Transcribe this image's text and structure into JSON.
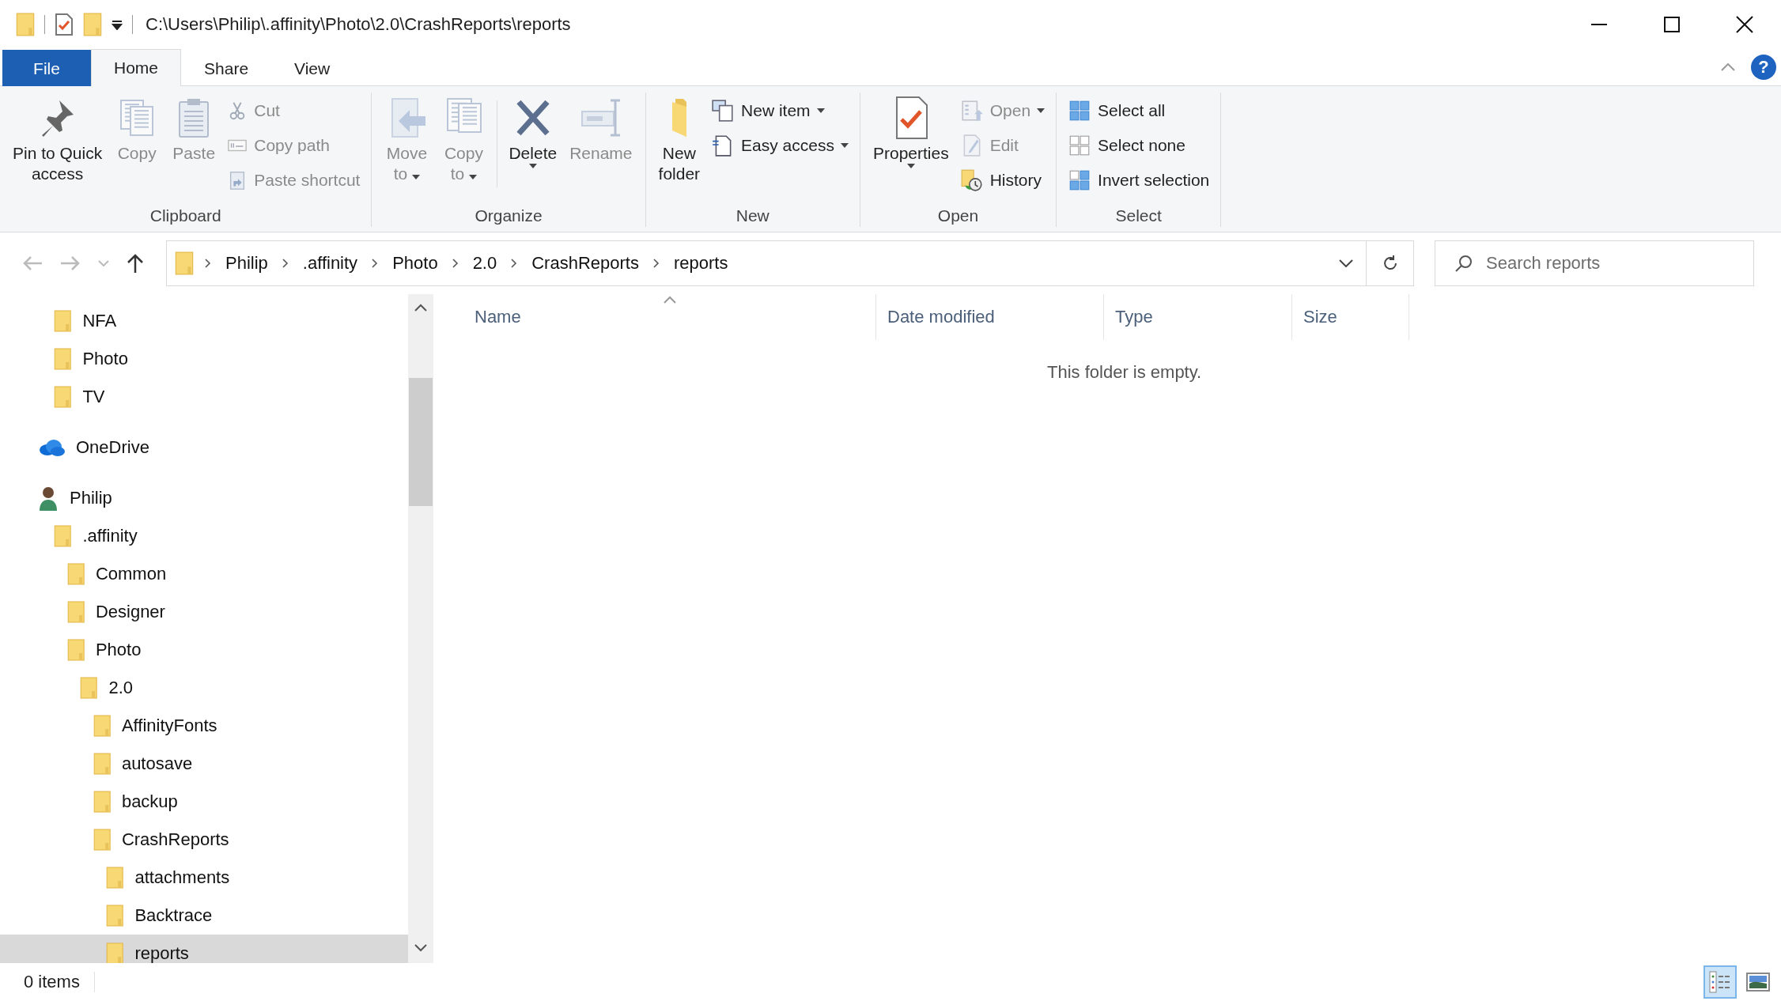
{
  "window": {
    "title": "C:\\Users\\Philip\\.affinity\\Photo\\2.0\\CrashReports\\reports"
  },
  "tabs": [
    {
      "label": "File",
      "kind": "file",
      "selected": false
    },
    {
      "label": "Home",
      "kind": "tab",
      "selected": true
    },
    {
      "label": "Share",
      "kind": "tab",
      "selected": false
    },
    {
      "label": "View",
      "kind": "tab",
      "selected": false
    }
  ],
  "help_label": "?",
  "ribbon": [
    {
      "label": "Clipboard",
      "items": [
        {
          "kind": "large",
          "label": "Pin to Quick\naccess",
          "disabled": false
        },
        {
          "kind": "large",
          "label": "Copy",
          "disabled": true
        },
        {
          "kind": "large",
          "label": "Paste",
          "disabled": true
        },
        {
          "kind": "stack",
          "buttons": [
            {
              "label": "Cut",
              "disabled": true
            },
            {
              "label": "Copy path",
              "disabled": true
            },
            {
              "label": "Paste shortcut",
              "disabled": true
            }
          ]
        }
      ]
    },
    {
      "label": "Organize",
      "items": [
        {
          "kind": "large",
          "label": "Move\nto",
          "disabled": true,
          "dropdown": true,
          "caret_below": false
        },
        {
          "kind": "large",
          "label": "Copy\nto",
          "disabled": true,
          "dropdown": true,
          "caret_below": false
        },
        {
          "kind": "divider"
        },
        {
          "kind": "large",
          "label": "Delete",
          "disabled": false,
          "dropdown": true,
          "caret_below": true
        },
        {
          "kind": "large",
          "label": "Rename",
          "disabled": true
        }
      ]
    },
    {
      "label": "New",
      "items": [
        {
          "kind": "large",
          "label": "New\nfolder",
          "disabled": false
        },
        {
          "kind": "stack",
          "buttons": [
            {
              "label": "New item",
              "disabled": false,
              "dropdown": true
            },
            {
              "label": "Easy access",
              "disabled": false,
              "dropdown": true
            }
          ]
        }
      ]
    },
    {
      "label": "Open",
      "items": [
        {
          "kind": "large",
          "label": "Properties",
          "disabled": false,
          "dropdown": true,
          "caret_below": true
        },
        {
          "kind": "stack",
          "buttons": [
            {
              "label": "Open",
              "disabled": true,
              "dropdown": true
            },
            {
              "label": "Edit",
              "disabled": true
            },
            {
              "label": "History",
              "disabled": false
            }
          ]
        }
      ]
    },
    {
      "label": "Select",
      "items": [
        {
          "kind": "stack",
          "buttons": [
            {
              "label": "Select all",
              "disabled": false
            },
            {
              "label": "Select none",
              "disabled": false
            },
            {
              "label": "Invert selection",
              "disabled": false
            }
          ]
        }
      ]
    }
  ],
  "breadcrumb": [
    "Philip",
    ".affinity",
    "Photo",
    "2.0",
    "CrashReports",
    "reports"
  ],
  "search": {
    "placeholder": "Search reports"
  },
  "nav": {
    "partial_items": [
      {
        "label": "NFA",
        "selected": false
      },
      {
        "label": "Photo",
        "selected": false
      },
      {
        "label": "TV",
        "selected": false
      }
    ],
    "tree": [
      {
        "label": "OneDrive",
        "kind": "cloud",
        "selected": false
      },
      {
        "label": "Philip",
        "kind": "user",
        "selected": false,
        "children": [
          {
            "label": ".affinity",
            "kind": "folder",
            "selected": false,
            "children": [
              {
                "label": "Common",
                "kind": "folder",
                "selected": false
              },
              {
                "label": "Designer",
                "kind": "folder",
                "selected": false
              },
              {
                "label": "Photo",
                "kind": "folder",
                "selected": false,
                "children": [
                  {
                    "label": "2.0",
                    "kind": "folder",
                    "selected": false,
                    "children": [
                      {
                        "label": "AffinityFonts",
                        "kind": "folder",
                        "selected": false
                      },
                      {
                        "label": "autosave",
                        "kind": "folder",
                        "selected": false
                      },
                      {
                        "label": "backup",
                        "kind": "folder",
                        "selected": false
                      },
                      {
                        "label": "CrashReports",
                        "kind": "folder",
                        "selected": false,
                        "children": [
                          {
                            "label": "attachments",
                            "kind": "folder",
                            "selected": false
                          },
                          {
                            "label": "Backtrace",
                            "kind": "folder",
                            "selected": false
                          },
                          {
                            "label": "reports",
                            "kind": "folder",
                            "selected": true
                          }
                        ]
                      }
                    ]
                  }
                ]
              }
            ]
          }
        ]
      }
    ]
  },
  "columns": [
    {
      "label": "Name",
      "sorted": true
    },
    {
      "label": "Date modified",
      "sorted": false
    },
    {
      "label": "Type",
      "sorted": false
    },
    {
      "label": "Size",
      "sorted": false
    }
  ],
  "empty_message": "This folder is empty.",
  "status_bar": {
    "count": "0 items",
    "views": [
      {
        "kind": "details",
        "selected": true
      },
      {
        "kind": "large_icons",
        "selected": false
      }
    ]
  }
}
